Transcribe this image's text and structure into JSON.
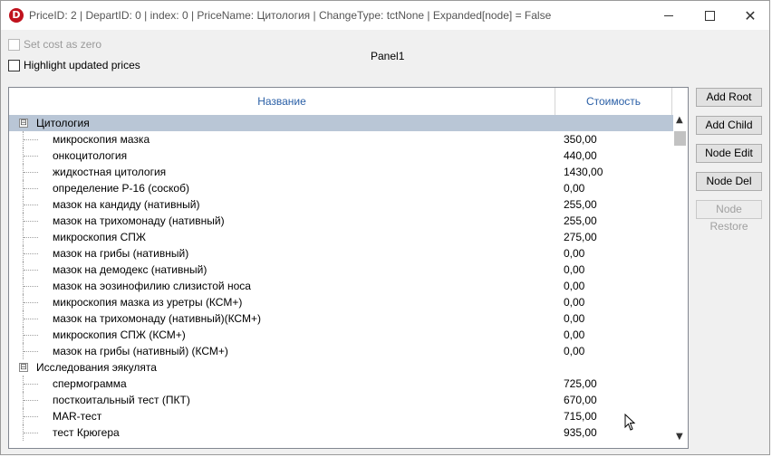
{
  "window": {
    "title": "PriceID: 2 | DepartID: 0 | index: 0 | PriceName: Цитология | ChangeType: tctNone | Expanded[node] = False",
    "icon_letter": "D",
    "controls": {
      "minimize": "minimize-icon",
      "maximize": "maximize-icon",
      "close": "✕"
    }
  },
  "options": {
    "set_cost_zero": {
      "label": "Set cost as zero",
      "checked": false,
      "enabled": false
    },
    "highlight_updated": {
      "label": "Highlight updated prices",
      "checked": false,
      "enabled": true
    }
  },
  "panel_label": "Panel1",
  "tree": {
    "columns": {
      "name": "Название",
      "cost": "Стоимость"
    },
    "groups": [
      {
        "name": "Цитология",
        "expander": "⊟",
        "selected": true,
        "items": [
          {
            "name": "микроскопия мазка",
            "price": "350,00"
          },
          {
            "name": "онкоцитология",
            "price": "440,00"
          },
          {
            "name": "жидкостная цитология",
            "price": "1430,00"
          },
          {
            "name": "определение Р-16 (соскоб)",
            "price": "0,00"
          },
          {
            "name": "мазок на кандиду (нативный)",
            "price": "255,00"
          },
          {
            "name": "мазок на трихомонаду (нативный)",
            "price": "255,00"
          },
          {
            "name": "микроскопия СПЖ",
            "price": "275,00"
          },
          {
            "name": "мазок на грибы (нативный)",
            "price": "0,00"
          },
          {
            "name": "мазок на демодекс (нативный)",
            "price": "0,00"
          },
          {
            "name": "мазок на эозинофилию слизистой носа",
            "price": "0,00"
          },
          {
            "name": "микроскопия мазка из уретры (КСМ+)",
            "price": "0,00"
          },
          {
            "name": "мазок на трихомонаду (нативный)(КСМ+)",
            "price": "0,00"
          },
          {
            "name": "микроскопия СПЖ (КСМ+)",
            "price": "0,00"
          },
          {
            "name": "мазок на грибы (нативный) (КСМ+)",
            "price": "0,00"
          }
        ]
      },
      {
        "name": "Исследования эякулята",
        "expander": "⊟",
        "selected": false,
        "items": [
          {
            "name": "спермограмма",
            "price": "725,00"
          },
          {
            "name": "посткоитальный тест (ПКТ)",
            "price": "670,00"
          },
          {
            "name": "MAR-тест",
            "price": "715,00"
          },
          {
            "name": "тест Крюгера",
            "price": "935,00"
          }
        ]
      }
    ],
    "scrollbar": {
      "up": "▲",
      "down": "▼"
    }
  },
  "buttons": {
    "add_root": {
      "label": "Add Root",
      "enabled": true
    },
    "add_child": {
      "label": "Add Child",
      "enabled": true
    },
    "node_edit": {
      "label": "Node Edit",
      "enabled": true
    },
    "node_del": {
      "label": "Node Del",
      "enabled": true
    },
    "node_restore": {
      "label": "Node Restore",
      "enabled": false
    }
  }
}
